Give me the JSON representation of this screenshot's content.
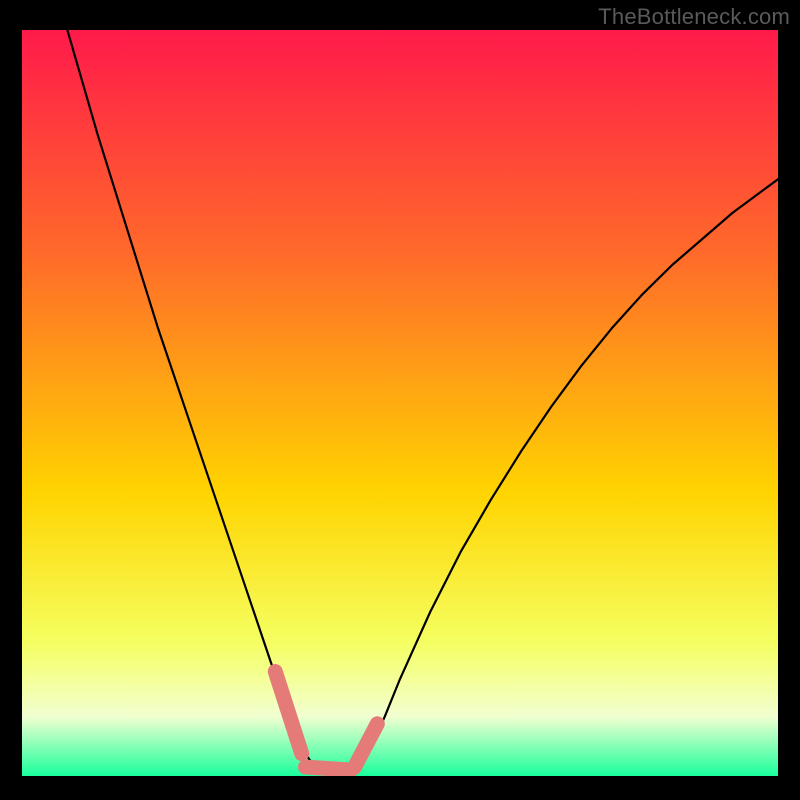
{
  "watermark": "TheBottleneck.com",
  "colors": {
    "page_bg": "#000000",
    "gradient_top": "#ff1a4a",
    "gradient_mid_upper": "#ff6a2a",
    "gradient_mid": "#ffd400",
    "gradient_lower": "#f5ff60",
    "gradient_pale": "#f2ffd0",
    "gradient_bottom": "#19ff9c",
    "curve": "#000000",
    "marker": "#e57b78",
    "watermark": "#5a5a5a"
  },
  "chart_data": {
    "type": "line",
    "title": "",
    "xlabel": "",
    "ylabel": "",
    "xlim": [
      0,
      100
    ],
    "ylim": [
      0,
      100
    ],
    "series": [
      {
        "name": "bottleneck-curve",
        "x": [
          6,
          8,
          10,
          12,
          14,
          16,
          18,
          20,
          22,
          24,
          26,
          28,
          30,
          32,
          33,
          34,
          35,
          36,
          37,
          38,
          39,
          40,
          41,
          42,
          43,
          44,
          46,
          48,
          50,
          54,
          58,
          62,
          66,
          70,
          74,
          78,
          82,
          86,
          90,
          94,
          98,
          100
        ],
        "y": [
          100,
          93,
          86,
          79.5,
          73,
          66.5,
          60,
          54,
          48,
          42,
          36,
          30,
          24,
          18,
          15,
          12,
          9,
          6.5,
          4,
          2.2,
          1.2,
          0.7,
          0.5,
          0.5,
          0.6,
          1.0,
          3.5,
          8,
          13,
          22,
          30,
          37,
          43.5,
          49.5,
          55,
          60,
          64.5,
          68.5,
          72,
          75.5,
          78.5,
          80
        ]
      }
    ],
    "markers": [
      {
        "name": "left-marker",
        "x": [
          33.5,
          37
        ],
        "y": [
          14,
          3
        ]
      },
      {
        "name": "bottom-marker",
        "x": [
          37.5,
          43.5
        ],
        "y": [
          1.2,
          0.8
        ]
      },
      {
        "name": "right-marker",
        "x": [
          44,
          47
        ],
        "y": [
          1.2,
          7
        ]
      }
    ],
    "gradient_stops": [
      {
        "offset": 0.0,
        "color_key": "gradient_top"
      },
      {
        "offset": 0.3,
        "color_key": "gradient_mid_upper"
      },
      {
        "offset": 0.62,
        "color_key": "gradient_mid"
      },
      {
        "offset": 0.82,
        "color_key": "gradient_lower"
      },
      {
        "offset": 0.92,
        "color_key": "gradient_pale"
      },
      {
        "offset": 1.0,
        "color_key": "gradient_bottom"
      }
    ]
  }
}
